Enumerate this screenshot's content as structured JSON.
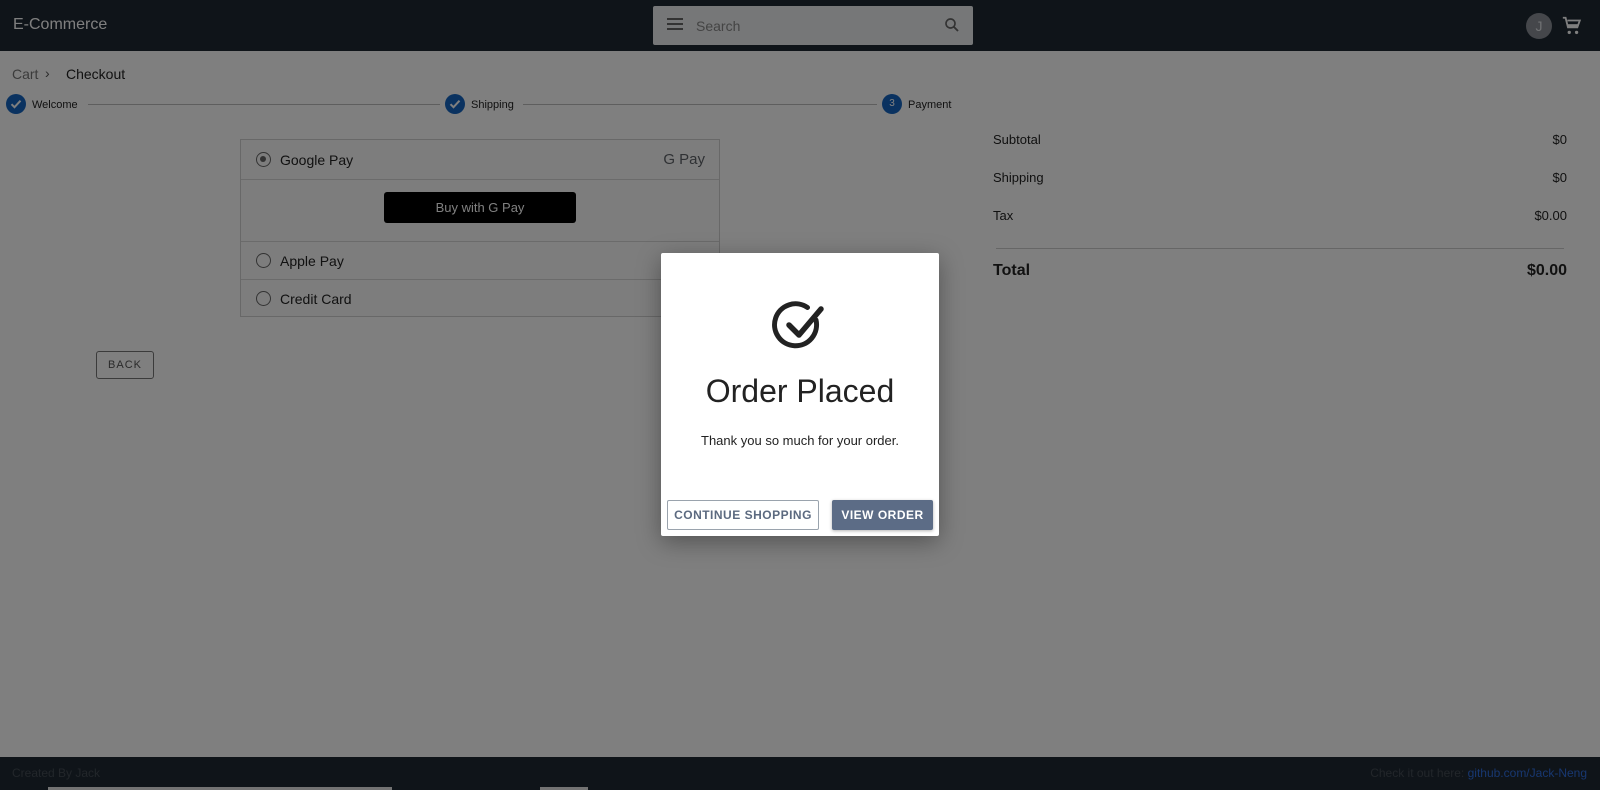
{
  "header": {
    "brand": "E-Commerce",
    "search_placeholder": "Search",
    "avatar_initial": "J"
  },
  "breadcrumb": {
    "items": [
      "Cart",
      "Checkout"
    ],
    "separator": "›"
  },
  "stepper": {
    "steps": [
      {
        "label": "Welcome",
        "state": "done"
      },
      {
        "label": "Shipping",
        "state": "done"
      },
      {
        "label": "Payment",
        "state": "active",
        "number": "3"
      }
    ]
  },
  "payment": {
    "options": [
      {
        "label": "Google Pay",
        "selected": true,
        "logo_text": "G Pay"
      },
      {
        "label": "Apple Pay",
        "selected": false
      },
      {
        "label": "Credit Card",
        "selected": false
      }
    ],
    "buy_button": "Buy with G Pay",
    "back_button": "BACK"
  },
  "summary": {
    "rows": [
      {
        "label": "Subtotal",
        "value": "$0"
      },
      {
        "label": "Shipping",
        "value": "$0"
      },
      {
        "label": "Tax",
        "value": "$0.00"
      }
    ],
    "total_label": "Total",
    "total_value": "$0.00"
  },
  "footer": {
    "left": "Created By Jack",
    "right_prefix": "Check it out here:",
    "right_link": "github.com/Jack-Neng"
  },
  "dialog": {
    "title": "Order Placed",
    "message": "Thank you so much for your order.",
    "continue_button": "CONTINUE SHOPPING",
    "view_button": "VIEW ORDER"
  },
  "colors": {
    "appbar": "#1f2933",
    "step_accent": "#1565c0",
    "primary_button": "#5c6c86",
    "link": "#2f6ee0"
  }
}
